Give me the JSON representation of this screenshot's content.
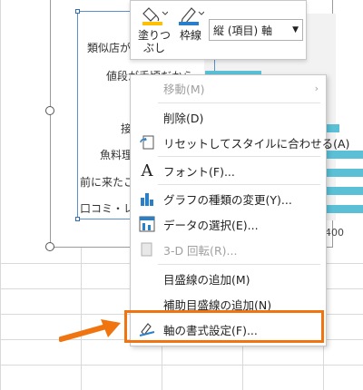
{
  "chart": {
    "categories": [
      "類似店が",
      "値段が手頃だから",
      "接",
      "魚料理",
      "前に来たこ",
      "口コミ・レ"
    ],
    "tick_label": "400",
    "bar_color": "#5bc0d6"
  },
  "minibar": {
    "fill": {
      "label_line1": "塗りつ",
      "label_line2": "ぶし",
      "icon": "paint-bucket-icon",
      "color": "#ffc000"
    },
    "outline": {
      "label": "枠線",
      "icon": "pen-icon",
      "color": "#2a7fc9"
    },
    "element_select": {
      "value": "縦 (項目) 軸"
    }
  },
  "menu": {
    "items": [
      {
        "label": "移動(M)",
        "icon": "",
        "disabled": true,
        "submenu": true
      },
      {
        "label": "削除(D)",
        "icon": "",
        "disabled": false
      },
      {
        "label": "リセットしてスタイルに合わせる(A)",
        "icon": "reset-style-icon",
        "disabled": false
      },
      {
        "label": "フォント(F)...",
        "icon": "font-icon",
        "disabled": false
      },
      {
        "label": "グラフの種類の変更(Y)...",
        "icon": "chart-type-icon",
        "disabled": false
      },
      {
        "label": "データの選択(E)...",
        "icon": "select-data-icon",
        "disabled": false
      },
      {
        "label": "3-D 回転(R)...",
        "icon": "3d-rotation-icon",
        "disabled": true
      },
      {
        "label": "目盛線の追加(M)",
        "icon": "",
        "disabled": false
      },
      {
        "label": "補助目盛線の追加(N)",
        "icon": "",
        "disabled": false
      },
      {
        "label": "軸の書式設定(F)...",
        "icon": "format-axis-icon",
        "disabled": false
      }
    ]
  },
  "accent": {
    "highlight": "#f0740f"
  }
}
